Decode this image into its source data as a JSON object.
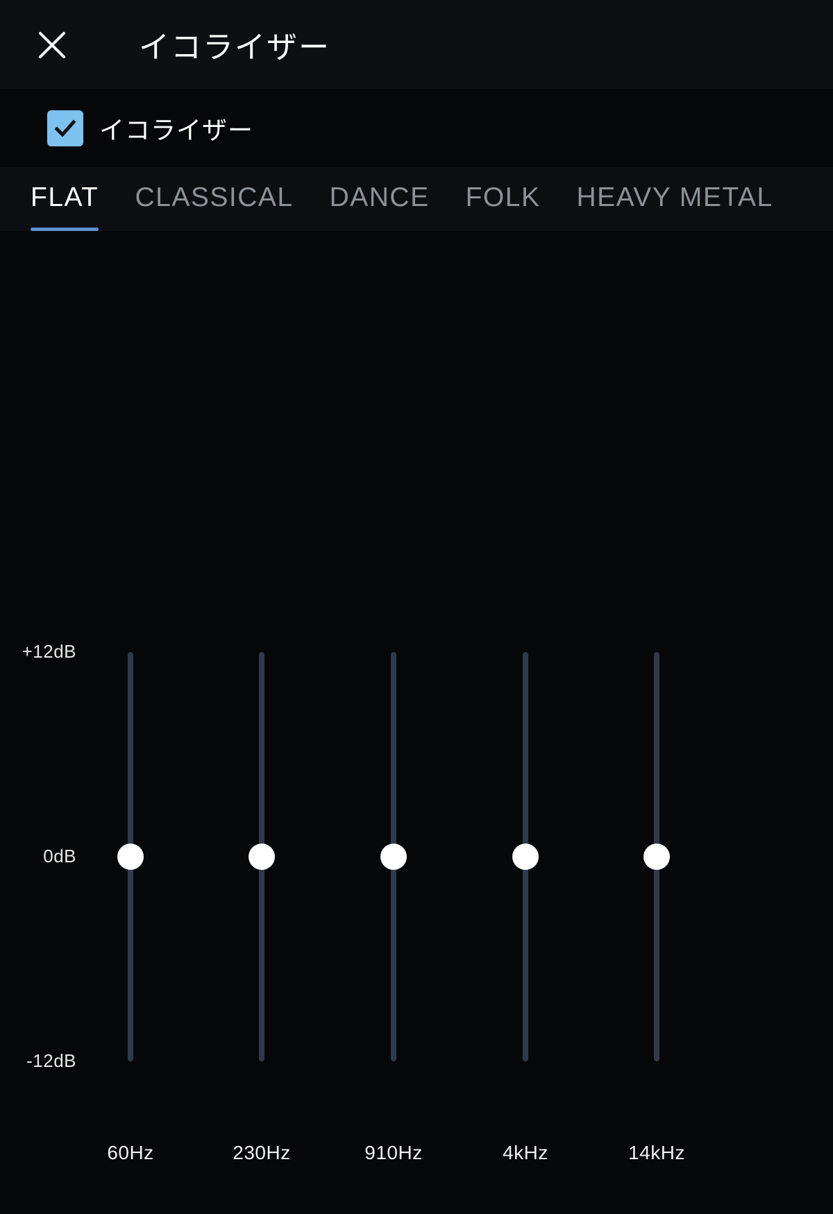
{
  "header": {
    "title": "イコライザー",
    "close_icon": "close-icon"
  },
  "enable": {
    "label": "イコライザー",
    "checked": true,
    "checkbox_color": "#7ec2ef"
  },
  "tabs": {
    "active_index": 0,
    "accent_color": "#5f8fd0",
    "items": [
      {
        "label": "FLAT"
      },
      {
        "label": "CLASSICAL"
      },
      {
        "label": "DANCE"
      },
      {
        "label": "FOLK"
      },
      {
        "label": "HEAVY METAL"
      }
    ]
  },
  "equalizer": {
    "scale_labels": {
      "max": "+12dB",
      "mid": "0dB",
      "min": "-12dB"
    },
    "track_color": "#303a4d",
    "thumb_color": "#ffffff",
    "bands": [
      {
        "freq_label": "60Hz",
        "value_db": 0
      },
      {
        "freq_label": "230Hz",
        "value_db": 0
      },
      {
        "freq_label": "910Hz",
        "value_db": 0
      },
      {
        "freq_label": "4kHz",
        "value_db": 0
      },
      {
        "freq_label": "14kHz",
        "value_db": 0
      }
    ]
  }
}
